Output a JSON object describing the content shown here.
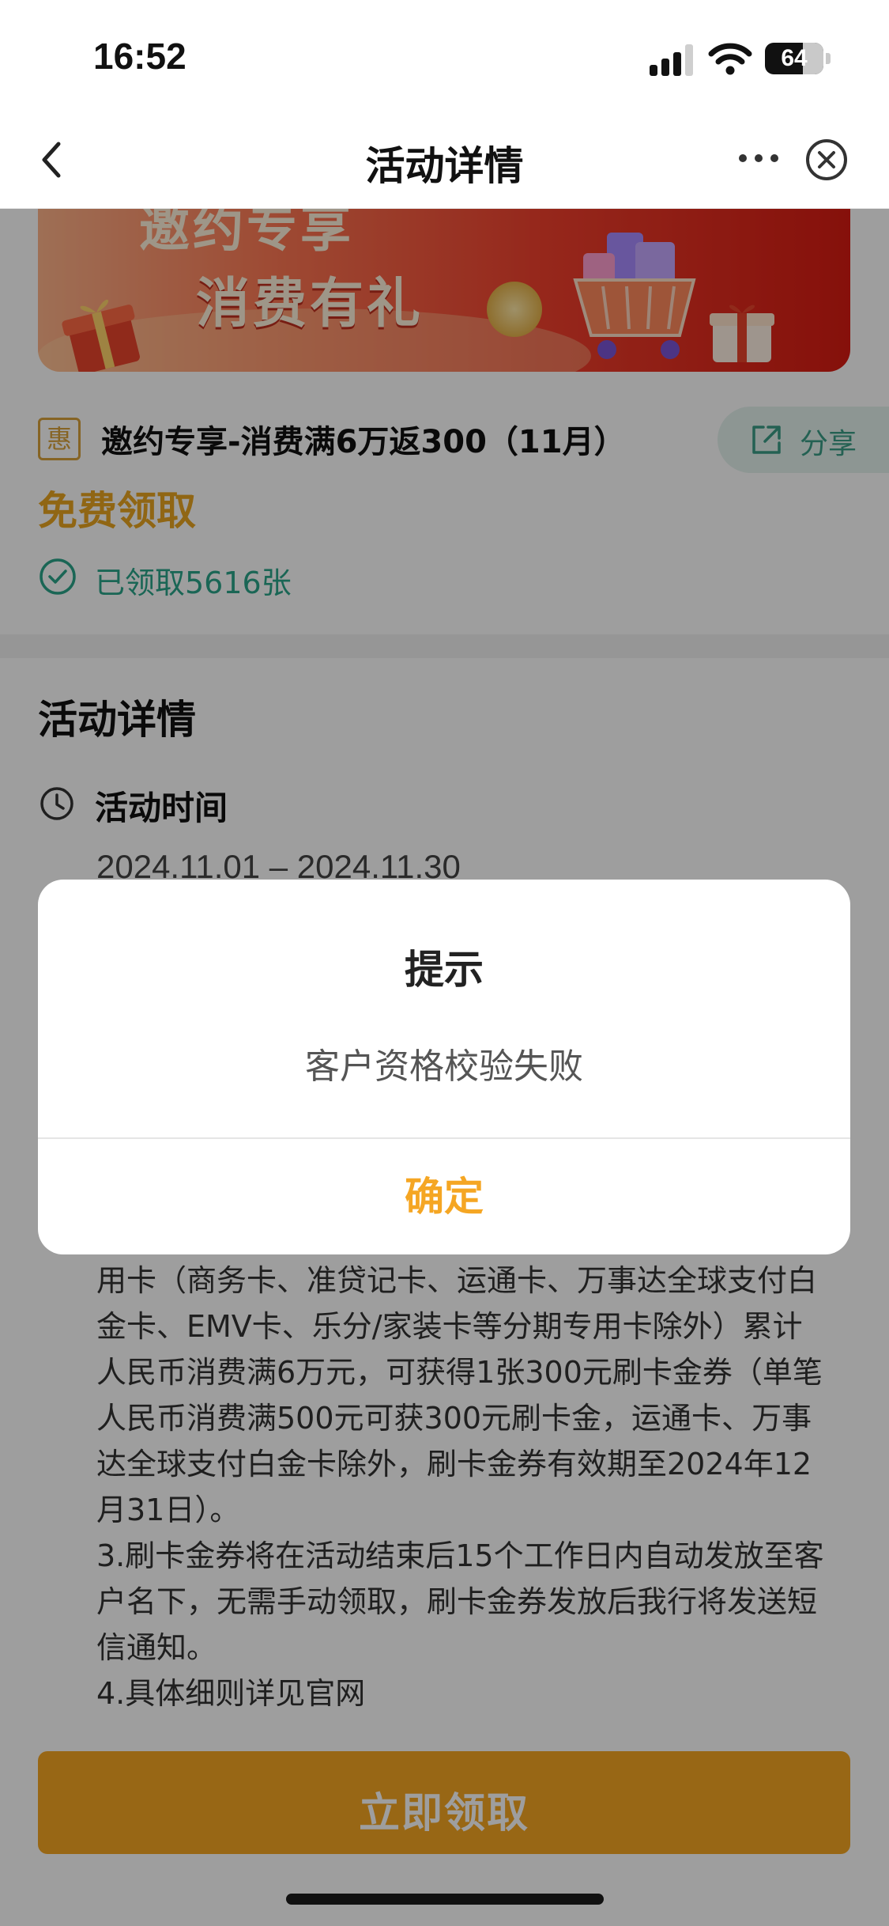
{
  "status_bar": {
    "time": "16:52",
    "battery": "64",
    "icons": [
      "signal-icon",
      "wifi-icon",
      "battery-icon"
    ]
  },
  "nav": {
    "title": "活动详情",
    "icons": [
      "back-chevron-icon",
      "more-dots-icon",
      "close-circle-icon"
    ]
  },
  "banner": {
    "line1": "邀约专享",
    "line2": "消费有礼"
  },
  "offer": {
    "tag": "惠",
    "title": "邀约专享-消费满6万返300（11月）",
    "share_label": "分享",
    "price": "免费领取",
    "claimed": "已领取5616张"
  },
  "details": {
    "section_title": "活动详情",
    "time_label": "活动时间",
    "time_range": "2024.11.01 – 2024.11.30",
    "rules": [
      "2.报名成功后，11月1日至11月30日，使用名下我行信用卡（商务卡、准贷记卡、运通卡、万事达全球支付白金卡、EMV卡、乐分/家装卡等分期专用卡除外）累计人民币消费满6万元，可获得1张300元刷卡金券（单笔人民币消费满500元可获300元刷卡金，运通卡、万事达全球支付白金卡除外，刷卡金券有效期至2024年12月31日）。",
      "3.刷卡金券将在活动结束后15个工作日内自动发放至客户名下，无需手动领取，刷卡金券发放后我行将发送短信通知。",
      "4.具体细则详见官网"
    ]
  },
  "claim_button": "立即领取",
  "dialog": {
    "title": "提示",
    "message": "客户资格校验失败",
    "confirm": "确定"
  },
  "colors": {
    "accent": "#f5a623",
    "teal": "#2aa58a",
    "mask": "rgba(0,0,0,0.38)"
  }
}
